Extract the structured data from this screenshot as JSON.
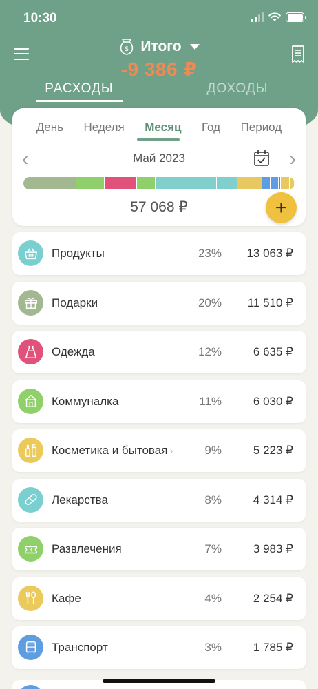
{
  "status": {
    "time": "10:30"
  },
  "header": {
    "title": "Итого",
    "total": "-9 386 ₽",
    "tab_expenses": "РАСХОДЫ",
    "tab_income": "ДОХОДЫ"
  },
  "periods": [
    "День",
    "Неделя",
    "Месяц",
    "Год",
    "Период"
  ],
  "active_period": "Месяц",
  "month": "Май 2023",
  "sum": "57 068 ₽",
  "add_label": "+",
  "stack_colors": [
    "#a2b890",
    "#8fd06a",
    "#e0527a",
    "#8fd06a",
    "#7fd0cc",
    "#7fd0cc",
    "#e8c860",
    "#5e9ee0",
    "#5e9ee0",
    "#e0527a",
    "#e8c860",
    "#e8c860"
  ],
  "categories": [
    {
      "name": "Продукты",
      "pct": "23%",
      "amount": "13 063 ₽",
      "color": "#7ad0d0",
      "icon": "basket-icon"
    },
    {
      "name": "Подарки",
      "pct": "20%",
      "amount": "11 510 ₽",
      "color": "#a2b890",
      "icon": "gift-icon"
    },
    {
      "name": "Одежда",
      "pct": "12%",
      "amount": "6 635 ₽",
      "color": "#e0527a",
      "icon": "dress-icon"
    },
    {
      "name": "Коммуналка",
      "pct": "11%",
      "amount": "6 030 ₽",
      "color": "#8fd06a",
      "icon": "house-icon"
    },
    {
      "name": "Косметика и бытовая",
      "chevron": "›",
      "pct": "9%",
      "amount": "5 223 ₽",
      "color": "#ebc95a",
      "icon": "cosmetics-icon"
    },
    {
      "name": "Лекарства",
      "pct": "8%",
      "amount": "4 314 ₽",
      "color": "#7ad0d0",
      "icon": "pill-icon"
    },
    {
      "name": "Развлечения",
      "pct": "7%",
      "amount": "3 983 ₽",
      "color": "#8fd06a",
      "icon": "ticket-icon"
    },
    {
      "name": "Кафе",
      "pct": "4%",
      "amount": "2 254 ₽",
      "color": "#ebc95a",
      "icon": "cutlery-icon"
    },
    {
      "name": "Транспорт",
      "pct": "3%",
      "amount": "1 785 ₽",
      "color": "#5e9ee0",
      "icon": "bus-icon"
    }
  ]
}
